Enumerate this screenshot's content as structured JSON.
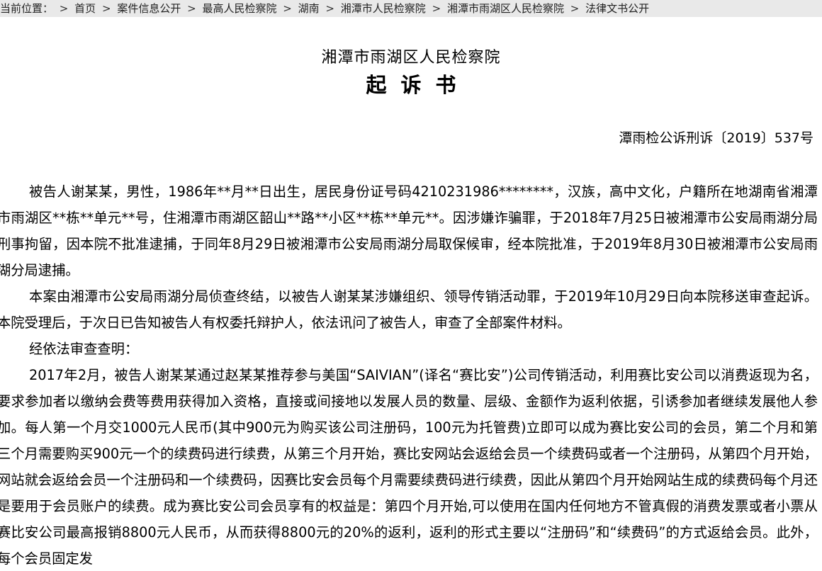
{
  "breadcrumb": {
    "prefix": "当前位置：",
    "items": [
      "首页",
      "案件信息公开",
      "最高人民检察院",
      "湖南",
      "湘潭市人民检察院",
      "湘潭市雨湖区人民检察院",
      "法律文书公开"
    ],
    "separator": ">"
  },
  "document": {
    "org": "湘潭市雨湖区人民检察院",
    "title": "起诉书",
    "number": "潭雨检公诉刑诉〔2019〕537号",
    "paragraphs": [
      "被告人谢某某，男性，1986年**月**日出生，居民身份证号码4210231986********，汉族，高中文化，户籍所在地湖南省湘潭市雨湖区**栋**单元**号，住湘潭市雨湖区韶山**路**小区**栋**单元**。因涉嫌诈骗罪，于2018年7月25日被湘潭市公安局雨湖分局刑事拘留，因本院不批准逮捕，于同年8月29日被湘潭市公安局雨湖分局取保候审，经本院批准，于2019年8月30日被湘潭市公安局雨湖分局逮捕。",
      "本案由湘潭市公安局雨湖分局侦查终结，以被告人谢某某涉嫌组织、领导传销活动罪，于2019年10月29日向本院移送审查起诉。本院受理后，于次日已告知被告人有权委托辩护人，依法讯问了被告人，审查了全部案件材料。",
      "经依法审查查明：",
      "2017年2月，被告人谢某某通过赵某某推荐参与美国“SAIVIAN”(译名“赛比安”)公司传销活动，利用赛比安公司以消费返现为名，要求参加者以缴纳会费等费用获得加入资格，直接或间接地以发展人员的数量、层级、金额作为返利依据，引诱参加者继续发展他人参加。每人第一个月交1000元人民币(其中900元为购买该公司注册码，100元为托管费)立即可以成为赛比安公司的会员，第二个月和第三个月需要购买900元一个的续费码进行续费，从第三个月开始，赛比安网站会返给会员一个续费码或者一个注册码，从第四个月开始，网站就会返给会员一个注册码和一个续费码，因赛比安会员每个月需要续费码进行续费，因此从第四个月开始网站生成的续费码每个月还是要用于会员账户的续费。成为赛比安公司会员享有的权益是：第四个月开始,可以使用在国内任何地方不管真假的消费发票或者小票从赛比安公司最高报销8800元人民币，从而获得8800元的20%的返利，返利的形式主要以“注册码”和“续费码”的方式返给会员。此外，每个会员固定发"
    ]
  }
}
